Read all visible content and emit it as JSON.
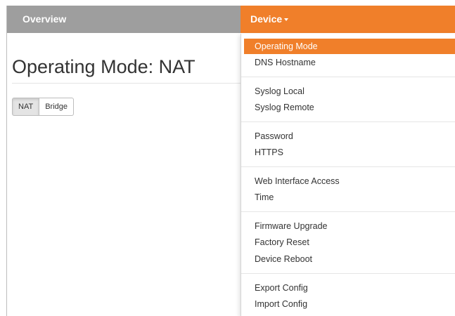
{
  "navbar": {
    "overview_label": "Overview",
    "device_label": "Device"
  },
  "page": {
    "title": "Operating Mode: NAT"
  },
  "mode_buttons": {
    "nat_label": "NAT",
    "bridge_label": "Bridge",
    "selected": "NAT"
  },
  "device_menu": {
    "items": [
      {
        "label": "Operating Mode"
      },
      {
        "label": "DNS Hostname"
      },
      {
        "label": "Syslog Local"
      },
      {
        "label": "Syslog Remote"
      },
      {
        "label": "Password"
      },
      {
        "label": "HTTPS"
      },
      {
        "label": "Web Interface Access"
      },
      {
        "label": "Time"
      },
      {
        "label": "Firmware Upgrade"
      },
      {
        "label": "Factory Reset"
      },
      {
        "label": "Device Reboot"
      },
      {
        "label": "Export Config"
      },
      {
        "label": "Import Config"
      }
    ],
    "active_item": "Operating Mode"
  },
  "colors": {
    "accent": "#f07f2a",
    "navbar": "#9e9e9e"
  }
}
